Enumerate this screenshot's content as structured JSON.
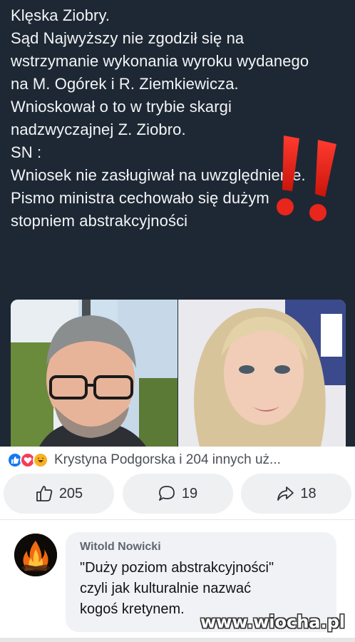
{
  "post": {
    "text": "Klęska Ziobry.\nSąd Najwyższy nie zgodził się na wstrzymanie wykonania wyroku wydanego na M. Ogórek i R. Ziemkiewicza.\nWnioskował o to w trybie skargi nadzwyczajnej Z. Ziobro.\nSN :\nWniosek nie zasługiwał na uwzględnienie.\nPismo ministra cechowało się dużym stopniem abstrakcyjności",
    "background_color": "#1e2834",
    "decoration_icon": "double-exclamation-icon"
  },
  "reactions": {
    "icons": [
      "like-icon",
      "love-icon",
      "haha-icon"
    ],
    "text": "Krystyna Podgorska i 204 innych uż..."
  },
  "actions": {
    "like_count": "205",
    "comment_count": "19",
    "share_count": "18"
  },
  "comment": {
    "author": "Witold Nowicki",
    "text": "\"Duży poziom abstrakcyjności\"\nczyli jak kulturalnie nazwać\nkogoś kretynem.",
    "avatar_icon": "campfire-icon"
  },
  "watermark": "www.wiocha.pl"
}
